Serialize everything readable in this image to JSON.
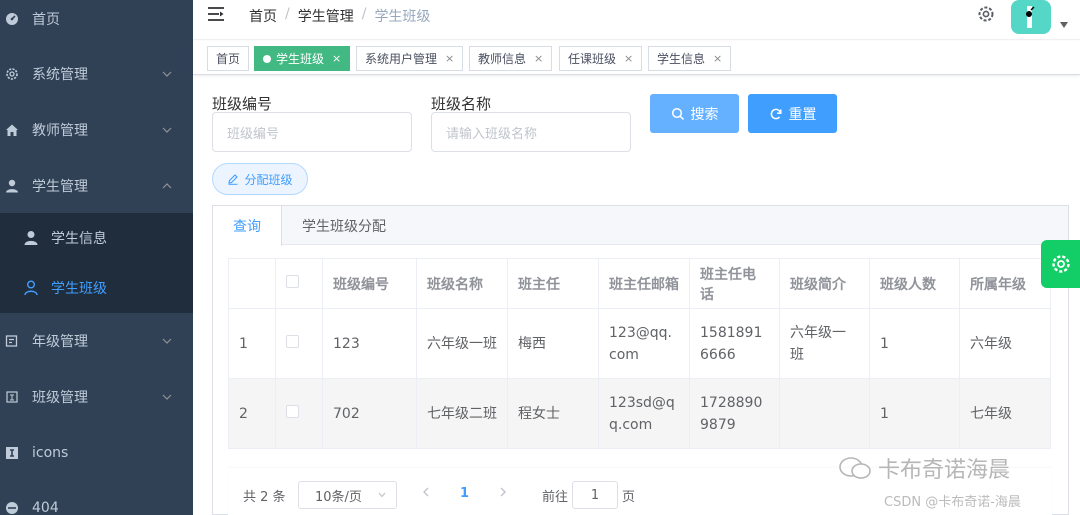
{
  "sidebar": {
    "items": [
      {
        "label": "首页",
        "icon": "dashboard-icon"
      },
      {
        "label": "系统管理",
        "icon": "gear-icon"
      },
      {
        "label": "教师管理",
        "icon": "home-icon"
      },
      {
        "label": "学生管理",
        "icon": "user-icon"
      },
      {
        "label": "年级管理",
        "icon": "form-icon"
      },
      {
        "label": "班级管理",
        "icon": "seal-icon"
      },
      {
        "label": "icons",
        "icon": "icons-icon"
      },
      {
        "label": "404",
        "icon": "error-icon"
      }
    ],
    "submenu": [
      {
        "label": "学生信息",
        "icon": "user-solid-icon"
      },
      {
        "label": "学生班级",
        "icon": "user-outline-icon",
        "active": true
      }
    ],
    "active_color": "#409eff",
    "bg_color": "#304156"
  },
  "navbar": {
    "breadcrumb": [
      "首页",
      "学生管理",
      "学生班级"
    ]
  },
  "tags": [
    {
      "label": "首页"
    },
    {
      "label": "学生班级",
      "active": true
    },
    {
      "label": "系统用户管理"
    },
    {
      "label": "教师信息"
    },
    {
      "label": "任课班级"
    },
    {
      "label": "学生信息"
    }
  ],
  "search": {
    "class_no_label": "班级编号",
    "class_no_placeholder": "班级编号",
    "class_name_label": "班级名称",
    "class_name_placeholder": "请输入班级名称",
    "search_button": "搜索",
    "reset_button": "重置",
    "assign_button": "分配班级"
  },
  "tabs": [
    {
      "label": "查询",
      "active": true
    },
    {
      "label": "学生班级分配"
    }
  ],
  "table": {
    "headers": [
      "",
      "",
      "班级编号",
      "班级名称",
      "班主任",
      "班主任邮箱",
      "班主任电话",
      "班级简介",
      "班级人数",
      "所属年级"
    ],
    "rows": [
      [
        "1",
        "",
        "123",
        "六年级一班",
        "梅西",
        "123@qq.com",
        "15818916666",
        "六年级一班",
        "1",
        "六年级"
      ],
      [
        "2",
        "",
        "702",
        "七年级二班",
        "程女士",
        "123sd@qq.com",
        "17288909879",
        "",
        "1",
        "七年级"
      ]
    ]
  },
  "pagination": {
    "total": "共 2 条",
    "page_size": "10条/页",
    "current_page": "1",
    "goto_label": "前往",
    "goto_value": "1",
    "goto_unit": "页"
  },
  "watermark": {
    "main": "卡布奇诺海晨",
    "sub": "CSDN @卡布奇诺-海晨"
  },
  "colors": {
    "primary": "#409eff",
    "tag_active": "#42b983",
    "settings_float": "#13ce66"
  }
}
